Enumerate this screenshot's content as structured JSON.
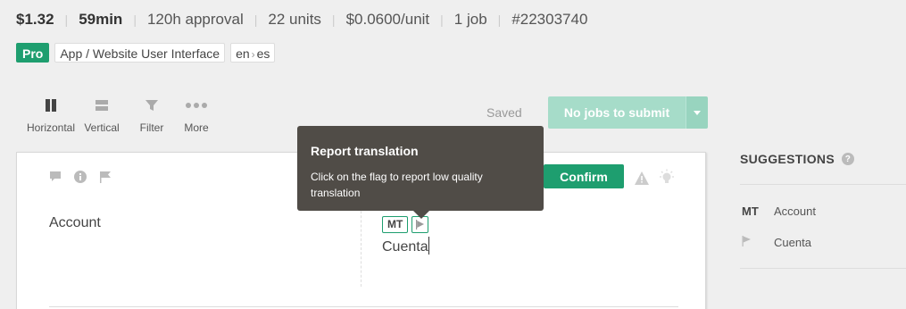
{
  "stats": {
    "price": "$1.32",
    "duration": "59min",
    "approval": "120h approval",
    "units": "22 units",
    "rate": "$0.0600/unit",
    "jobs": "1 job",
    "id": "#22303740"
  },
  "tags": {
    "pro": "Pro",
    "category": "App / Website User Interface",
    "source_lang": "en",
    "target_lang": "es"
  },
  "toolbar": {
    "horizontal": "Horizontal",
    "vertical": "Vertical",
    "filter": "Filter",
    "more": "More"
  },
  "status": {
    "saved": "Saved",
    "submit_label": "No jobs to submit"
  },
  "editor": {
    "source_text": "Account",
    "mt_badge": "MT",
    "target_text": "Cuenta",
    "confirm_label": "Confirm"
  },
  "tooltip": {
    "title": "Report translation",
    "body": "Click on the flag to report low quality translation"
  },
  "suggestions": {
    "title": "SUGGESTIONS",
    "help": "?",
    "rows": [
      {
        "label": "MT",
        "text": "Account"
      },
      {
        "label": "",
        "text": "Cuenta"
      }
    ]
  },
  "colors": {
    "accent": "#1e9e6f",
    "tooltip_bg": "#504c47",
    "submit_disabled": "#a6dcc9",
    "background": "#efefef"
  },
  "icons": [
    "columns-icon",
    "rows-icon",
    "filter-icon",
    "more-icon",
    "comment-icon",
    "info-icon",
    "flag-icon",
    "warning-icon",
    "lightbulb-icon",
    "chevron-down-icon"
  ]
}
